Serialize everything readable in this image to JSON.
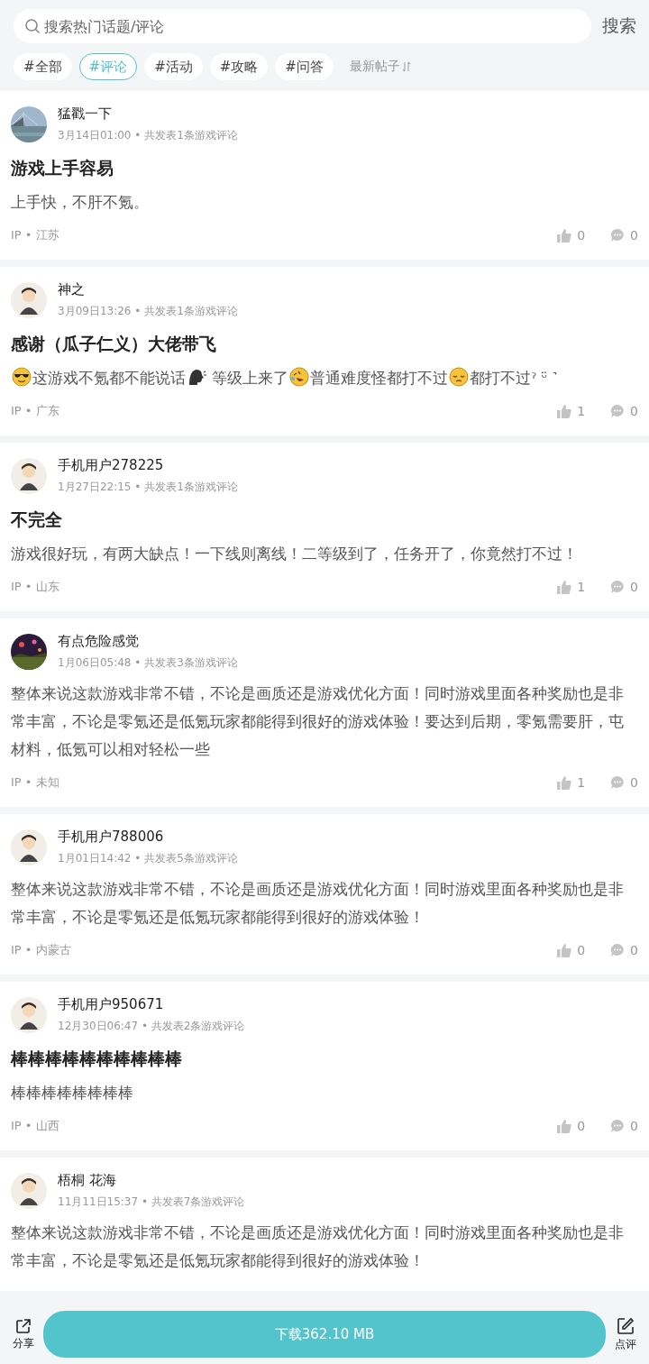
{
  "search": {
    "placeholder": "搜索热门话题/评论",
    "button": "搜索"
  },
  "tags": [
    {
      "label": "#全部",
      "selected": false
    },
    {
      "label": "#评论",
      "selected": true
    },
    {
      "label": "#活动",
      "selected": false
    },
    {
      "label": "#攻略",
      "selected": false
    },
    {
      "label": "#问答",
      "selected": false
    }
  ],
  "sort": {
    "label": "最新帖子"
  },
  "posts": [
    {
      "name": "猛戳一下",
      "meta": "3月14日01:00 • 共发表1条游戏评论",
      "title": "游戏上手容易",
      "body": [
        {
          "kind": "text",
          "text": "上手快，不肝不氪。"
        }
      ],
      "location": "IP • 江苏",
      "likes": "0",
      "comments": "0"
    },
    {
      "avatar": {
        "kind": "cartoon"
      },
      "name": "神之",
      "meta": "3月09日13:26 • 共发表1条游戏评论",
      "title": "感谢（瓜子仁义）大佬带飞",
      "body": [
        {
          "kind": "cool"
        },
        {
          "kind": "text",
          "text": "这游戏不氪都不能说话"
        },
        {
          "kind": "speaking"
        },
        {
          "kind": "text",
          "text": " 等级上来了"
        },
        {
          "kind": "laughing"
        },
        {
          "kind": "text",
          "text": "普通难度怪都打不过"
        },
        {
          "kind": "sad"
        },
        {
          "kind": "text",
          "text": "都打不过ˀ ᵕ̈ ˺"
        }
      ],
      "location": "IP • 广东",
      "likes": "1",
      "comments": "0"
    },
    {
      "avatar": {
        "kind": "cartoon"
      },
      "name": "手机用户278225",
      "meta": "1月27日22:15 • 共发表1条游戏评论",
      "title": "不完全",
      "body": [
        {
          "kind": "text",
          "text": "游戏很好玩，有两大缺点！一下线则离线！二等级到了，任务开了，你竟然打不过！"
        }
      ],
      "location": "IP • 山东",
      "likes": "1",
      "comments": "0"
    },
    {
      "avatar": {
        "kind": "night"
      },
      "name": "有点危险感觉",
      "meta": "1月06日05:48 • 共发表3条游戏评论",
      "body": [
        {
          "kind": "text",
          "text": "整体来说这款游戏非常不错，不论是画质还是游戏优化方面！同时游戏里面各种奖励也是非常丰富，不论是零氪还是低氪玩家都能得到很好的游戏体验！要达到后期，零氪需要肝，屯材料，低氪可以相对轻松一些"
        }
      ],
      "location": "IP • 未知",
      "likes": "1",
      "comments": "0"
    },
    {
      "avatar": {
        "kind": "cartoon"
      },
      "name": "手机用户788006",
      "meta": "1月01日14:42 • 共发表5条游戏评论",
      "body": [
        {
          "kind": "text",
          "text": "整体来说这款游戏非常不错，不论是画质还是游戏优化方面！同时游戏里面各种奖励也是非常丰富，不论是零氪还是低氪玩家都能得到很好的游戏体验！"
        }
      ],
      "location": "IP • 内蒙古",
      "likes": "0",
      "comments": "0"
    },
    {
      "avatar": {
        "kind": "cartoon"
      },
      "name": "手机用户950671",
      "meta": "12月30日06:47 • 共发表2条游戏评论",
      "title": "棒棒棒棒棒棒棒棒棒棒",
      "body": [
        {
          "kind": "text",
          "text": "棒棒棒棒棒棒棒棒"
        }
      ],
      "location": "IP • 山西",
      "likes": "0",
      "comments": "0"
    },
    {
      "avatar": {
        "kind": "cartoon"
      },
      "name": "梧桐 花海",
      "meta": "11月11日15:37 • 共发表7条游戏评论",
      "body": [
        {
          "kind": "text",
          "text": "整体来说这款游戏非常不错，不论是画质还是游戏优化方面！同时游戏里面各种奖励也是非常丰富，不论是零氪还是低氪玩家都能得到很好的游戏体验！"
        }
      ]
    }
  ],
  "bottom_bar": {
    "share": "分享",
    "download": "下载362.10 MB",
    "review": "点评"
  }
}
